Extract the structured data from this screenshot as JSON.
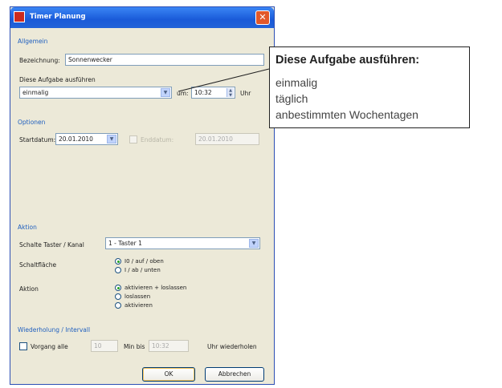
{
  "dialog": {
    "title": "Timer Planung",
    "close_glyph": "✕"
  },
  "allgemein": {
    "section_label": "Allgemein",
    "name_label": "Bezeichnung:",
    "name_value": "Sonnenwecker",
    "run_label": "Diese Aufgabe ausführen",
    "run_value": "einmalig",
    "at_label": "um:",
    "time_value": "10:32",
    "uhr_label": "Uhr"
  },
  "optionen": {
    "section_label": "Optionen",
    "start_label": "Startdatum:",
    "start_value": "20.01.2010",
    "end_label": "Enddatum:",
    "end_value": "20.01.2010"
  },
  "aktion": {
    "section_label": "Aktion",
    "channel_label": "Schalte Taster / Kanal",
    "channel_value": "1 - Taster 1",
    "area_label": "Schaltfläche",
    "area_options": [
      "I0 / auf / oben",
      "I / ab / unten"
    ],
    "action_label": "Aktion",
    "action_options": [
      "aktivieren + loslassen",
      "loslassen",
      "aktivieren"
    ]
  },
  "wiederholung": {
    "section_label": "Wiederholung / Intervall",
    "repeat_label": "Vorgang alle",
    "repeat_value": "10",
    "min_label": "Min bis",
    "until_value": "10:32",
    "uhr_repeat_label": "Uhr wiederholen"
  },
  "buttons": {
    "ok": "OK",
    "cancel": "Abbrechen"
  },
  "callout": {
    "title": "Diese Aufgabe ausführen:",
    "options": [
      "einmalig",
      "täglich",
      "anbestimmten Wochentagen"
    ]
  },
  "colors": {
    "titlebar": "#1a5ad8",
    "dialog_bg": "#ece9d8",
    "section_text": "#1f5fbf"
  }
}
